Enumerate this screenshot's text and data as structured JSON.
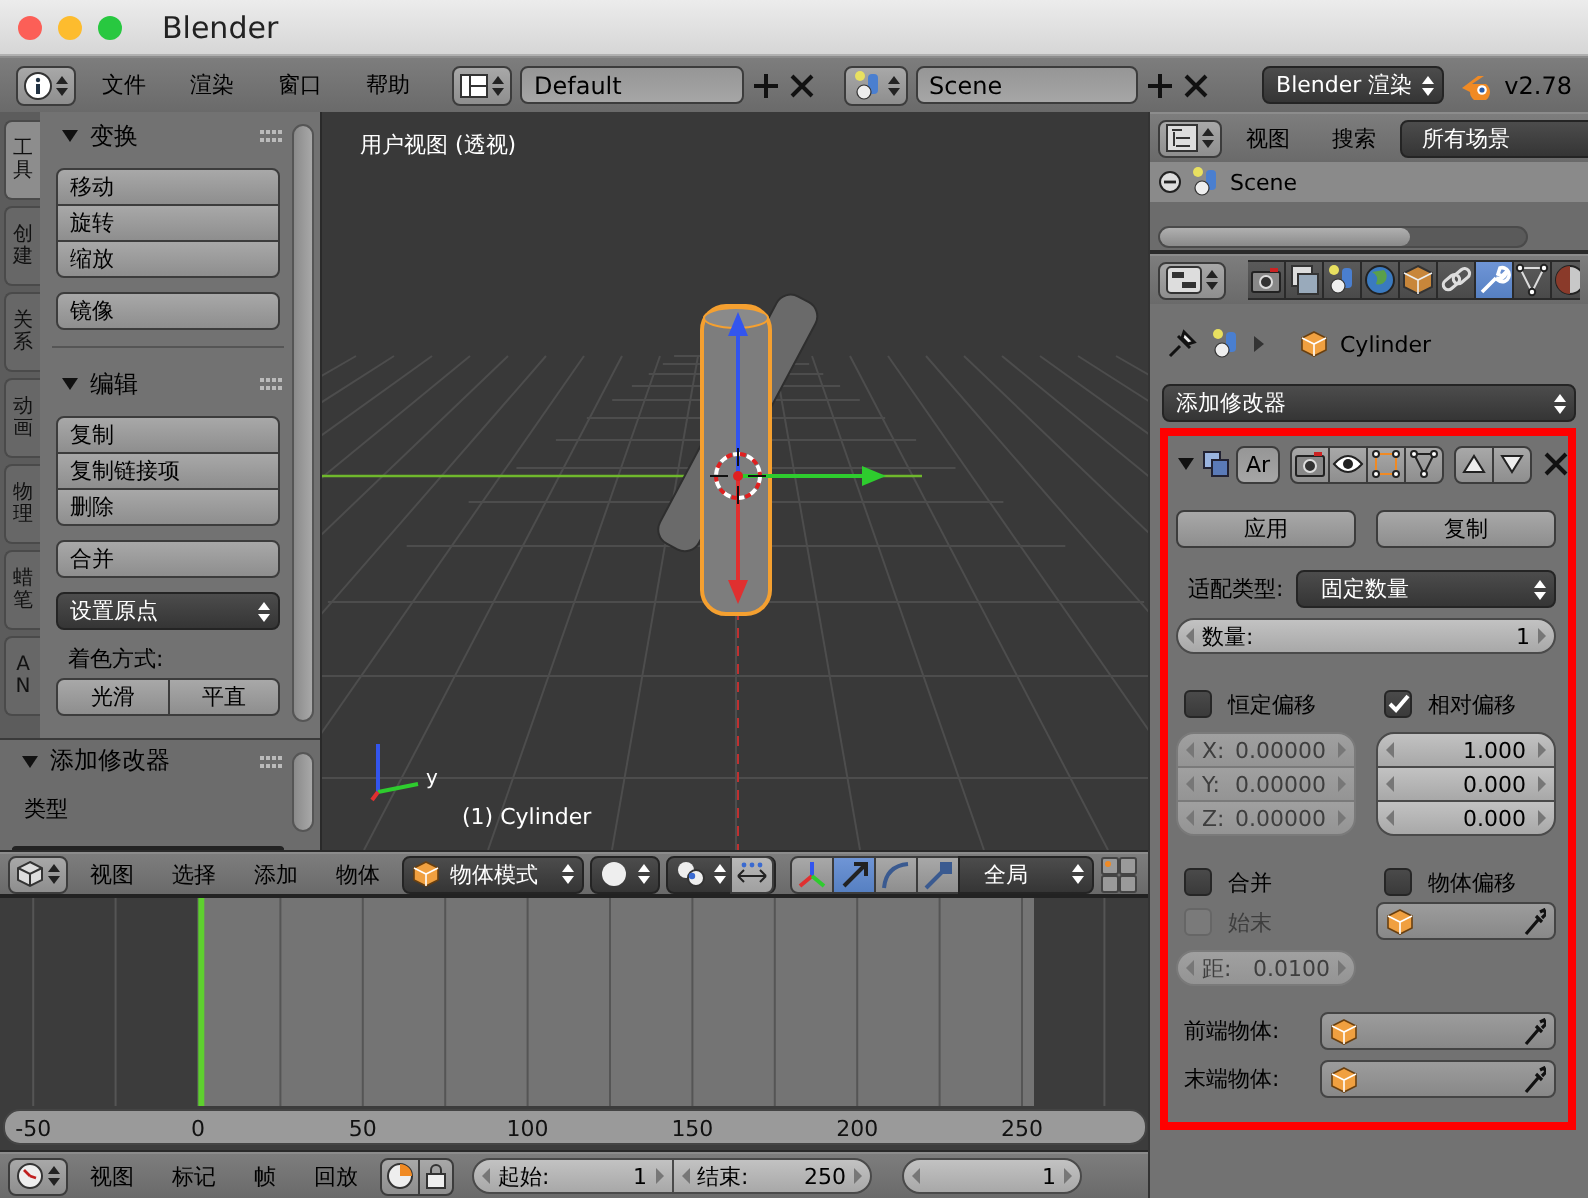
{
  "window": {
    "title": "Blender"
  },
  "info_header": {
    "menus": [
      "文件",
      "渲染",
      "窗口",
      "帮助"
    ],
    "screen_layout": "Default",
    "scene": "Scene",
    "render_engine": "Blender 渲染",
    "version": "v2.78"
  },
  "tool_shelf": {
    "tabs": [
      {
        "label": "工具",
        "selected": true
      },
      {
        "label": "创建",
        "selected": false
      },
      {
        "label": "关系",
        "selected": false
      },
      {
        "label": "动画",
        "selected": false
      },
      {
        "label": "物理",
        "selected": false
      },
      {
        "label": "蜡笔",
        "selected": false
      },
      {
        "label": "AN",
        "selected": false
      }
    ],
    "panels": [
      {
        "title": "变换",
        "expanded": true,
        "items": [
          {
            "kind": "group",
            "buttons": [
              "移动",
              "旋转",
              "缩放"
            ]
          },
          {
            "kind": "group",
            "buttons": [
              "镜像"
            ]
          }
        ]
      },
      {
        "title": "编辑",
        "expanded": true,
        "items": [
          {
            "kind": "group",
            "buttons": [
              "复制",
              "复制链接项",
              "删除"
            ]
          },
          {
            "kind": "group",
            "buttons": [
              "合并"
            ]
          },
          {
            "kind": "dropdown",
            "value": "设置原点"
          },
          {
            "kind": "label",
            "text": "着色方式:"
          },
          {
            "kind": "row",
            "buttons": [
              "光滑",
              "平直"
            ]
          }
        ]
      }
    ],
    "operator_panel": {
      "title": "添加修改器",
      "expanded": true,
      "label": "类型"
    }
  },
  "viewport": {
    "view_name": "用户视图 (透视)",
    "object_label": "(1) Cylinder",
    "axis_label": "y"
  },
  "viewport_header": {
    "menus": [
      "视图",
      "选择",
      "添加",
      "物体"
    ],
    "mode": "物体模式",
    "manipulators": [
      {
        "kind": "translate",
        "selected": true
      },
      {
        "kind": "rotate",
        "selected": false
      },
      {
        "kind": "scale",
        "selected": false
      }
    ],
    "orientation": "全局"
  },
  "timeline": {
    "ruler": [
      "-50",
      "0",
      "50",
      "100",
      "150",
      "200",
      "250"
    ]
  },
  "timeline_header": {
    "menus": [
      "视图",
      "标记",
      "帧",
      "回放"
    ],
    "start": {
      "label": "起始:",
      "value": "1"
    },
    "end": {
      "label": "结束:",
      "value": "250"
    },
    "current_frame": "1"
  },
  "outliner": {
    "menus": [
      "视图",
      "搜索"
    ],
    "filter": "所有场景",
    "items": [
      {
        "label": "Scene",
        "expanded": true,
        "selected": true
      }
    ]
  },
  "properties": {
    "tabs": [
      {
        "kind": "render",
        "selected": false
      },
      {
        "kind": "render_layers",
        "selected": false
      },
      {
        "kind": "scene",
        "selected": false
      },
      {
        "kind": "world",
        "selected": false
      },
      {
        "kind": "object",
        "selected": false
      },
      {
        "kind": "constraints",
        "selected": false
      },
      {
        "kind": "modifiers",
        "selected": true
      },
      {
        "kind": "data",
        "selected": false
      },
      {
        "kind": "material",
        "selected": false
      }
    ],
    "breadcrumb": "Cylinder",
    "add_modifier": "添加修改器",
    "modifier": {
      "expanded": true,
      "name": "Ar",
      "buttons": [
        "应用",
        "复制"
      ],
      "fit_type": {
        "label": "适配类型:",
        "value": "固定数量"
      },
      "count": {
        "label": "数量:",
        "value": "1"
      },
      "constant_offset": {
        "label": "恒定偏移",
        "checked": false,
        "fields": [
          {
            "label": "X:",
            "value": "0.00000",
            "disabled": true
          },
          {
            "label": "Y:",
            "value": "0.00000",
            "disabled": true
          },
          {
            "label": "Z:",
            "value": "0.00000",
            "disabled": true
          }
        ]
      },
      "relative_offset": {
        "label": "相对偏移",
        "checked": true,
        "fields": [
          {
            "value": "1.000",
            "disabled": false
          },
          {
            "value": "0.000",
            "disabled": false
          },
          {
            "value": "0.000",
            "disabled": false
          }
        ]
      },
      "merge": {
        "label": "合并",
        "checked": false
      },
      "object_offset": {
        "label": "物体偏移",
        "checked": false
      },
      "first_last": {
        "label": "始末",
        "checked": false,
        "disabled": true
      },
      "merge_distance": {
        "label": "距:",
        "value": "0.0100",
        "disabled": true
      },
      "start_cap": {
        "label": "前端物体:"
      },
      "end_cap": {
        "label": "末端物体:"
      }
    }
  }
}
